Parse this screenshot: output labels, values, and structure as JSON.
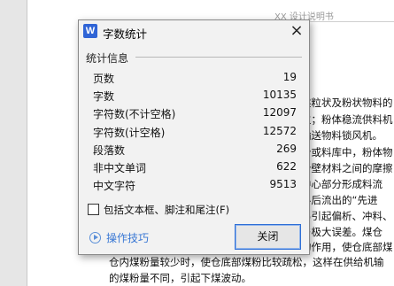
{
  "document": {
    "header": "XX 设计说明书",
    "lines": [
      "述粒状及粉状物料的",
      "生；粉体稳流供料机",
      "输送物料锁风机。",
      "仓或料库中，粉体物",
      "仓壁材料之间的摩擦",
      "中心部分形成料流",
      "料后流出的“先进",
      "易引起偏析、冲料、",
      "与极大误差。煤仓",
      "的作用，使仓底部煤",
      "仓内煤粉量较少时，使仓底部煤粉比较疏松，这样在供给机输",
      "的煤粉量不同，引起下煤波动。"
    ]
  },
  "dialog": {
    "app_icon": "W",
    "title": "字数统计",
    "close_icon": "×",
    "section_label": "统计信息",
    "stats": [
      {
        "label": "页数",
        "value": "19"
      },
      {
        "label": "字数",
        "value": "10135"
      },
      {
        "label": "字符数(不计空格)",
        "value": "12097"
      },
      {
        "label": "字符数(计空格)",
        "value": "12572"
      },
      {
        "label": "段落数",
        "value": "269"
      },
      {
        "label": "非中文单词",
        "value": "622"
      },
      {
        "label": "中文字符",
        "value": "9513"
      }
    ],
    "checkbox_label": "包括文本框、脚注和尾注(F)",
    "checkbox_checked": false,
    "tips_label": "操作技巧",
    "close_button_label": "关闭"
  },
  "colors": {
    "accent": "#2f64d6",
    "link": "#3a78d4"
  }
}
